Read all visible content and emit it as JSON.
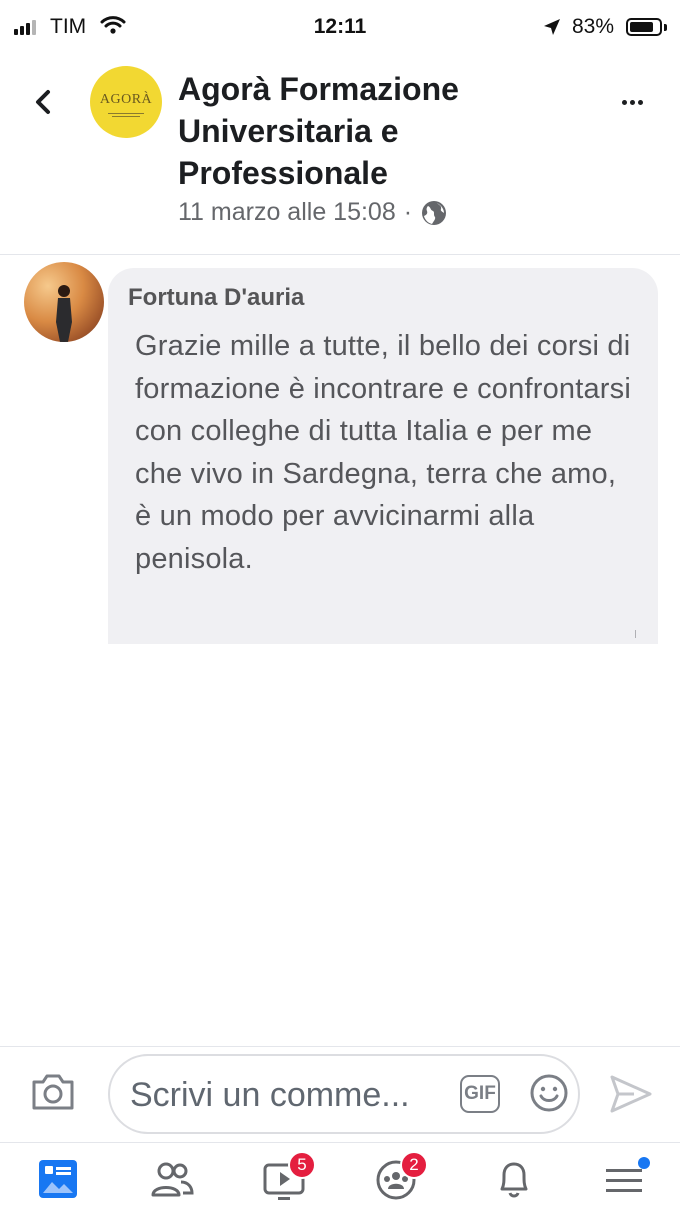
{
  "status_bar": {
    "carrier": "TIM",
    "time": "12:11",
    "battery_percent": "83%",
    "battery_level": 0.83
  },
  "header": {
    "page_title": "Agorà Formazione Universitaria e Professionale",
    "post_date": "11 marzo alle 15:08",
    "separator": "·",
    "page_logo_text": "AGORÀ",
    "privacy_icon": "globe-icon"
  },
  "comment": {
    "author": "Fortuna D'auria",
    "text": "Grazie mille a tutte, il bello dei corsi di formazione è incontrare e confrontarsi con colleghe di tutta Italia e per me che vivo in Sardegna, terra che amo, è un modo per avvicinarmi alla penisola."
  },
  "composer": {
    "placeholder": "Scrivi un comme...",
    "gif_label": "GIF"
  },
  "bottom_nav": {
    "items": [
      {
        "name": "news-feed",
        "icon": "news-feed-icon",
        "active": true
      },
      {
        "name": "friends",
        "icon": "friends-icon"
      },
      {
        "name": "watch",
        "icon": "watch-icon",
        "badge": "5"
      },
      {
        "name": "groups",
        "icon": "groups-icon",
        "badge": "2"
      },
      {
        "name": "notifications",
        "icon": "bell-icon"
      },
      {
        "name": "menu",
        "icon": "menu-icon",
        "dot": true
      }
    ]
  },
  "colors": {
    "accent": "#1877f2",
    "badge": "#e41e3f",
    "bubble": "#f0f0f3",
    "logo": "#f2d832"
  }
}
